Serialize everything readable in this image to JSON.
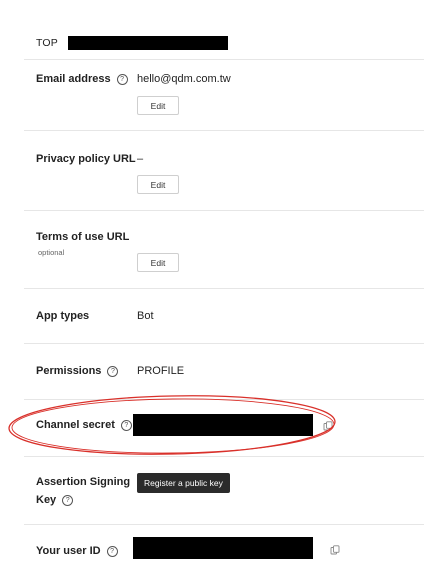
{
  "top": {
    "label": "TOP"
  },
  "rows": {
    "email": {
      "label": "Email address",
      "value": "hello@qdm.com.tw",
      "button": "Edit"
    },
    "privacy": {
      "label": "Privacy policy URL",
      "value": "–",
      "button": "Edit"
    },
    "terms": {
      "label": "Terms of use URL",
      "sublabel": "optional",
      "button": "Edit"
    },
    "app_types": {
      "label": "App types",
      "value": "Bot"
    },
    "permissions": {
      "label": "Permissions",
      "value": "PROFILE"
    },
    "channel_secret": {
      "label": "Channel secret"
    },
    "assertion": {
      "label_line1": "Assertion Signing",
      "label_line2": "Key",
      "button": "Register a public key"
    },
    "user_id": {
      "label": "Your user ID"
    }
  },
  "help_icon_glyph": "?",
  "icons": [
    "help-circle-icon",
    "copy-icon"
  ],
  "colors": {
    "annotation": "#d9302a",
    "redaction": "#000000",
    "dark_button": "#2b2b2b"
  }
}
